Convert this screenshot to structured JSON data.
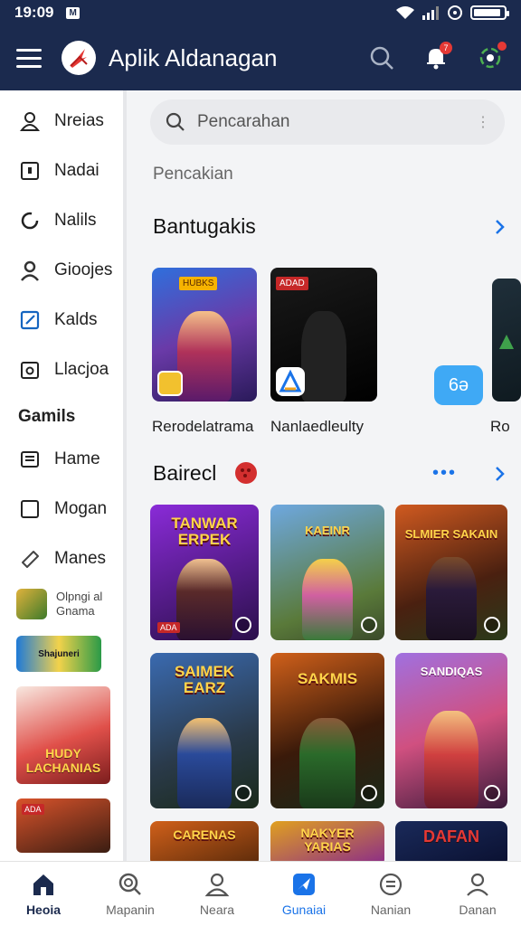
{
  "status_bar": {
    "time": "19:09",
    "carrier": "M"
  },
  "app_bar": {
    "title": "Aplik Aldanagan",
    "badge_count": "7"
  },
  "sidebar": {
    "items": [
      {
        "label": "Nreias",
        "icon": "user-outline-icon"
      },
      {
        "label": "Nadai",
        "icon": "lock-box-icon"
      },
      {
        "label": "Nalils",
        "icon": "refresh-circle-icon"
      },
      {
        "label": "Gioojes",
        "icon": "person-icon"
      },
      {
        "label": "Kalds",
        "icon": "edit-square-icon"
      },
      {
        "label": "Llacjoa",
        "icon": "camera-box-icon"
      }
    ],
    "section_header": "Gamils",
    "game_items": [
      {
        "label": "Hame",
        "icon": "list-box-icon"
      },
      {
        "label": "Mogan",
        "icon": "square-icon"
      },
      {
        "label": "Manes",
        "icon": "tag-icon"
      }
    ],
    "featured_game": {
      "line1": "Olpngi al",
      "line2": "Gnama"
    },
    "banner_text": "Shajuneri",
    "art_caption": "HUDY LACHANIAS",
    "art2_tag": "ADA"
  },
  "search": {
    "placeholder": "Pencarahan"
  },
  "main": {
    "sub_label": "Pencakian",
    "section1": {
      "title": "Bantugakis",
      "cards": [
        {
          "caption": "Rerodelatrama",
          "tag": "HUBKS"
        },
        {
          "caption": "Nanlaedleulty",
          "tag": "ADAD"
        },
        {
          "caption": "Ro"
        }
      ],
      "blue_badge": "6ə"
    },
    "section2": {
      "title": "Bairecl",
      "dots": "•••",
      "grid": [
        {
          "title": "TANWAR ERPEK",
          "tag": "ADA"
        },
        {
          "title": "KAEINR"
        },
        {
          "title": "SLMIER SAKAIN"
        },
        {
          "title": "SAIMEK EARZ"
        },
        {
          "title": "SAKMIS"
        },
        {
          "title": "SANDIQAS"
        },
        {
          "title": "CARENAS"
        },
        {
          "title": "NAKYER YARIAS"
        },
        {
          "title": "DAFAN"
        }
      ]
    }
  },
  "bottom_nav": [
    {
      "label": "Heoia",
      "icon": "home-icon"
    },
    {
      "label": "Mapanin",
      "icon": "search-circle-icon"
    },
    {
      "label": "Neara",
      "icon": "person-outline-icon"
    },
    {
      "label": "Gunaiai",
      "icon": "plane-tile-icon"
    },
    {
      "label": "Nanian",
      "icon": "smile-circle-icon"
    },
    {
      "label": "Danan",
      "icon": "profile-icon"
    }
  ],
  "colors": {
    "appbar": "#1b2a4e",
    "accent_blue": "#1a73e8",
    "badge_red": "#e53935"
  }
}
